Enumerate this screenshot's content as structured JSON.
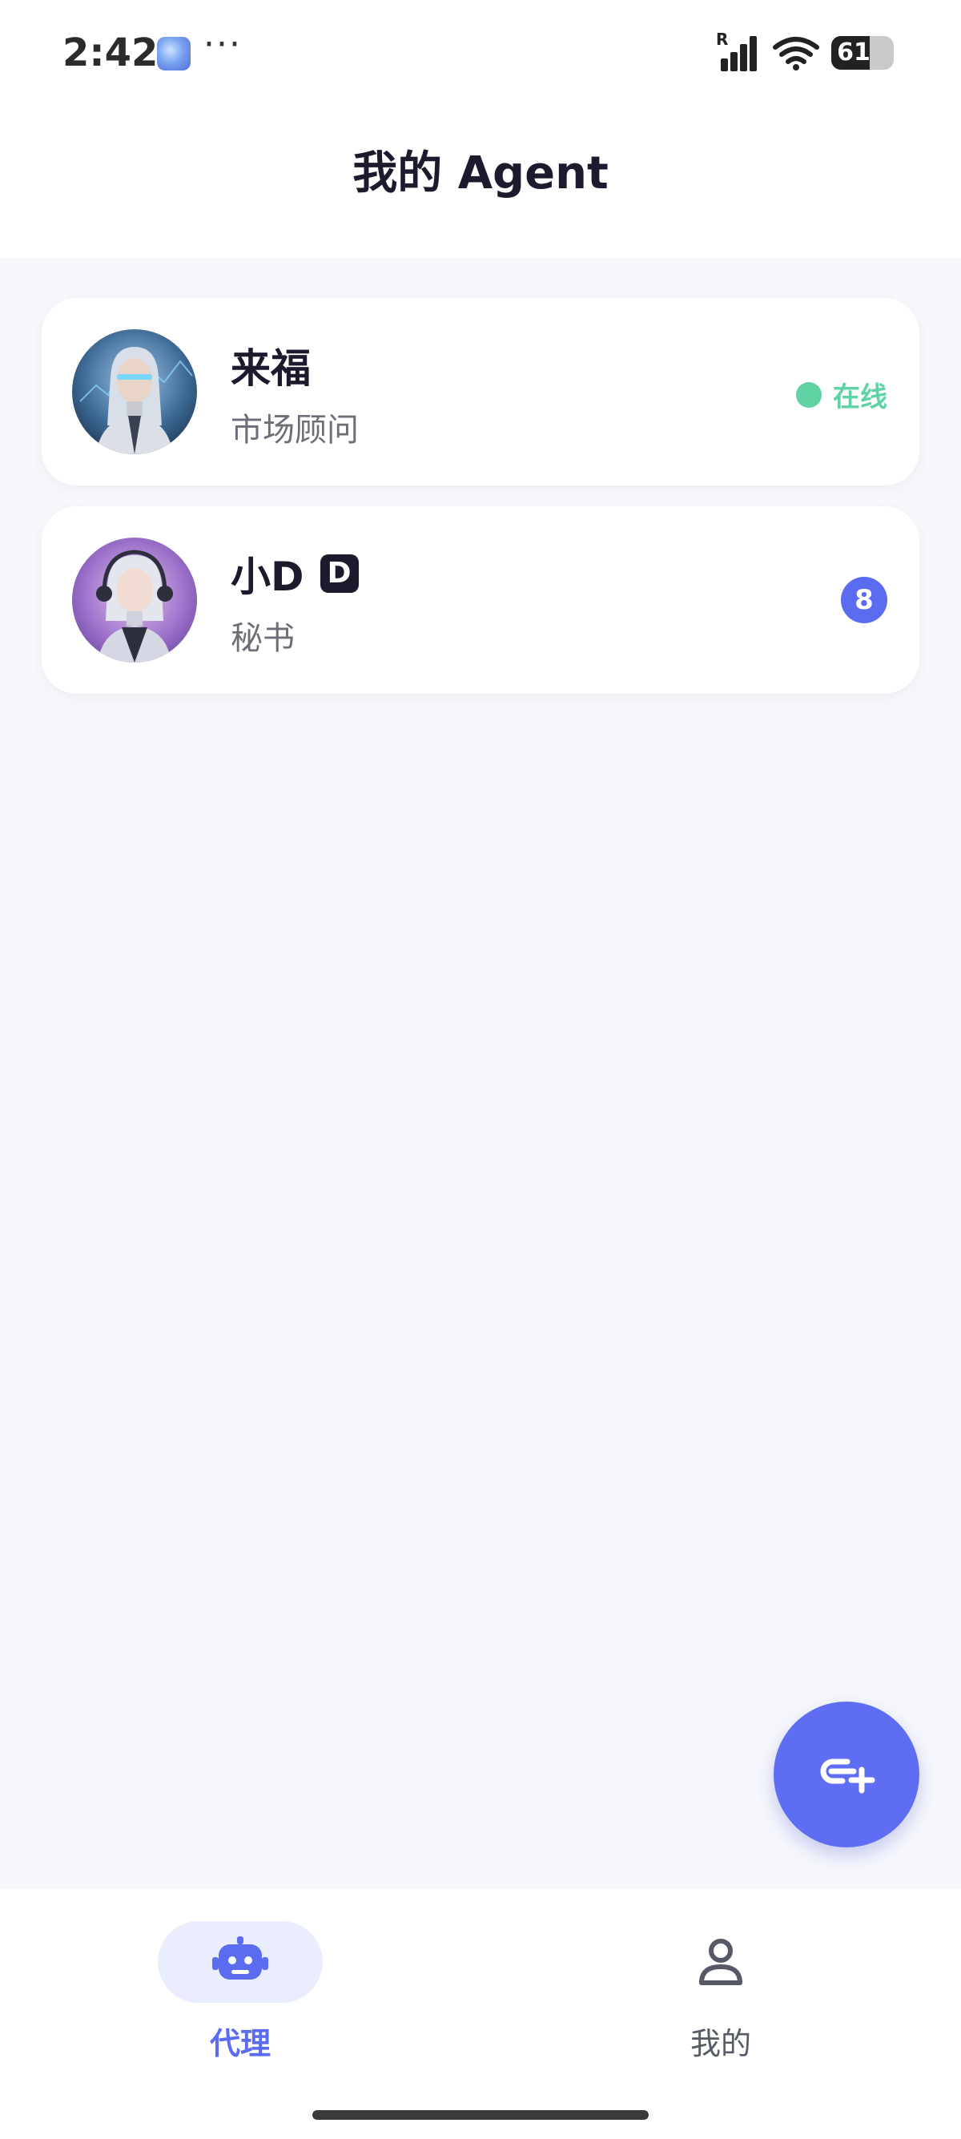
{
  "status_bar": {
    "time": "2:42",
    "more": "···",
    "network_label": "R",
    "battery_level": "61",
    "battery_fraction": 0.61
  },
  "header": {
    "title": "我的 Agent"
  },
  "agents": [
    {
      "name": "来福",
      "role": "市场顾问",
      "status": "在线",
      "status_color": "#5fd3a3"
    },
    {
      "name": "小D",
      "name_badge": "D",
      "role": "秘书",
      "unread_count": "8",
      "badge_color": "#5b6cf0"
    }
  ],
  "fab": {
    "icon": "add-chat-icon",
    "color": "#5f6df2"
  },
  "bottom_nav": {
    "items": [
      {
        "label": "代理",
        "icon": "robot-icon",
        "active": true
      },
      {
        "label": "我的",
        "icon": "person-icon",
        "active": false
      }
    ],
    "accent": "#5b6cf0"
  }
}
